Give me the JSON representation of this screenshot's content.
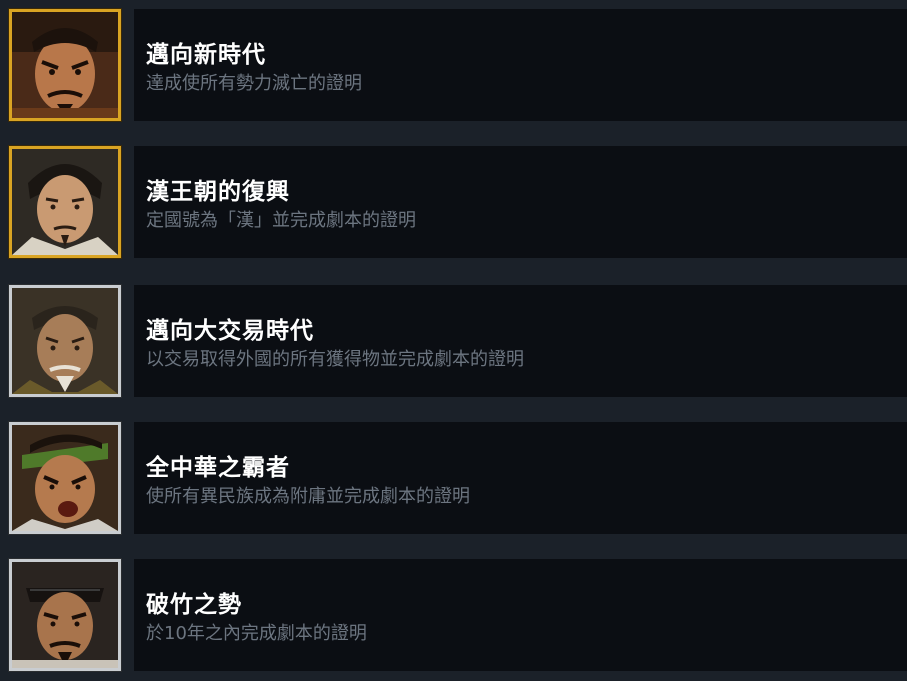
{
  "achievements": [
    {
      "title": "邁向新時代",
      "description": "達成使所有勢力滅亡的證明",
      "icon": "portrait-warlord-icon",
      "frame": "gold"
    },
    {
      "title": "漢王朝的復興",
      "description": "定國號為「漢」並完成劇本的證明",
      "icon": "portrait-han-lord-icon",
      "frame": "gold"
    },
    {
      "title": "邁向大交易時代",
      "description": "以交易取得外國的所有獲得物並完成劇本的證明",
      "icon": "portrait-elder-official-icon",
      "frame": "silver"
    },
    {
      "title": "全中華之霸者",
      "description": "使所有異民族成為附庸並完成劇本的證明",
      "icon": "portrait-shouting-warrior-icon",
      "frame": "silver"
    },
    {
      "title": "破竹之勢",
      "description": "於10年之內完成劇本的證明",
      "icon": "portrait-scholar-general-icon",
      "frame": "silver"
    }
  ],
  "colors": {
    "background": "#1b2129",
    "panel": "#0b0e13",
    "title": "#ffffff",
    "description": "#6c7580",
    "gold_frame": "#d9a423",
    "silver_frame": "#c9cdd1"
  }
}
